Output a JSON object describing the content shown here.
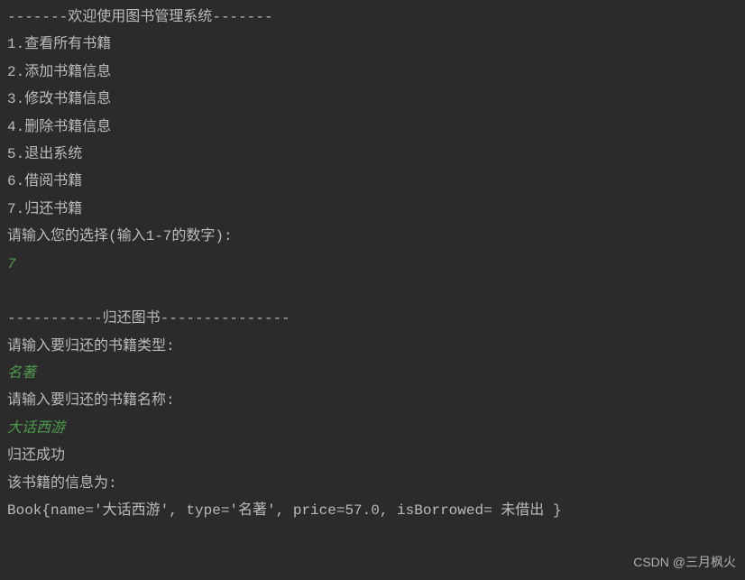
{
  "lines": [
    {
      "text": "-------欢迎使用图书管理系统-------",
      "cls": ""
    },
    {
      "text": "1.查看所有书籍",
      "cls": ""
    },
    {
      "text": "2.添加书籍信息",
      "cls": ""
    },
    {
      "text": "3.修改书籍信息",
      "cls": ""
    },
    {
      "text": "4.删除书籍信息",
      "cls": ""
    },
    {
      "text": "5.退出系统",
      "cls": ""
    },
    {
      "text": "6.借阅书籍",
      "cls": ""
    },
    {
      "text": "7.归还书籍",
      "cls": ""
    },
    {
      "text": "请输入您的选择(输入1-7的数字):",
      "cls": ""
    },
    {
      "text": "7",
      "cls": "input-green"
    },
    {
      "text": "",
      "cls": ""
    },
    {
      "text": "-----------归还图书---------------",
      "cls": ""
    },
    {
      "text": "请输入要归还的书籍类型:",
      "cls": ""
    },
    {
      "text": "名著",
      "cls": "input-green"
    },
    {
      "text": "请输入要归还的书籍名称:",
      "cls": ""
    },
    {
      "text": "大话西游",
      "cls": "input-green"
    },
    {
      "text": "归还成功",
      "cls": ""
    },
    {
      "text": "该书籍的信息为:",
      "cls": ""
    },
    {
      "text": "Book{name='大话西游', type='名著', price=57.0, isBorrowed= 未借出 }",
      "cls": ""
    }
  ],
  "watermark": "CSDN @三月枫火"
}
